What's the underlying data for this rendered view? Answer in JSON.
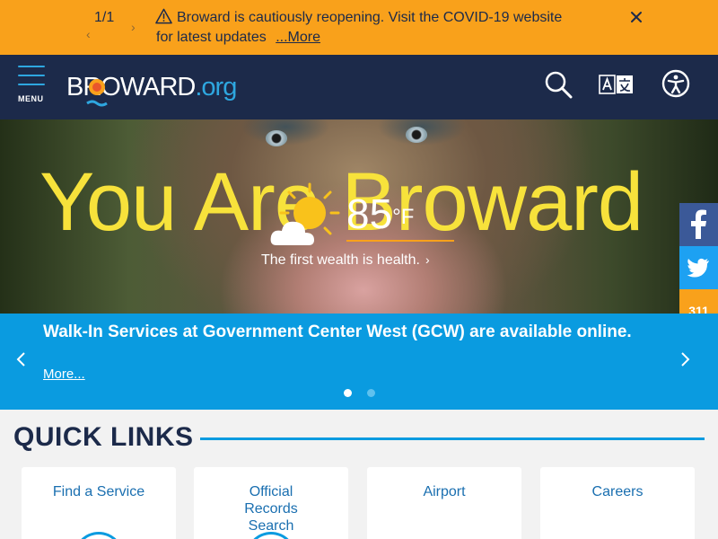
{
  "alert": {
    "counter": "1/1",
    "message": "Broward is cautiously reopening. Visit the COVID-19 website for latest updates",
    "more_label": "...More",
    "prev_label": "‹",
    "next_label": "›"
  },
  "header": {
    "menu_label": "MENU",
    "logo_main": "BROWARD",
    "logo_tld": ".org",
    "icons": [
      "search-icon",
      "translate-icon",
      "accessibility-icon"
    ]
  },
  "hero": {
    "title": "You Are Broward",
    "temperature": "85",
    "temperature_unit": "°F",
    "weather_icon": "partly-sunny-icon",
    "tagline": "The first wealth is health.",
    "tagline_chevron": "›"
  },
  "social": {
    "facebook_label": "f",
    "twitter_icon": "twitter-icon",
    "label_311": "311"
  },
  "banner": {
    "text": "Walk-In Services at Government Center West (GCW) are available online.",
    "more_label": "More...",
    "slide_count": 2,
    "active_slide": 1
  },
  "quick_links": {
    "title": "QUICK LINKS",
    "cards": [
      {
        "label": "Find a Service"
      },
      {
        "label": "Official Records Search"
      },
      {
        "label": "Airport"
      },
      {
        "label": "Careers"
      }
    ]
  },
  "colors": {
    "alert_bg": "#f9a11b",
    "header_bg": "#1c2a4a",
    "accent_blue": "#0a9be0",
    "hero_title": "#f7e23b",
    "card_text": "#1a6fb0"
  }
}
